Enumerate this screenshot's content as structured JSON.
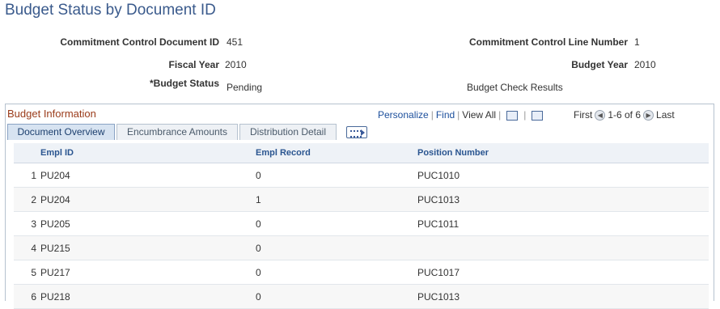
{
  "page_title": "Budget Status by Document ID",
  "fields": {
    "commitment_doc_id_label": "Commitment Control Document ID",
    "commitment_doc_id_value": "451",
    "commitment_line_label": "Commitment Control Line Number",
    "commitment_line_value": "1",
    "fiscal_year_label": "Fiscal Year",
    "fiscal_year_value": "2010",
    "budget_year_label": "Budget Year",
    "budget_year_value": "2010",
    "budget_status_label": "*Budget Status",
    "budget_status_value": "Pending",
    "budget_check_results_link": "Budget Check Results"
  },
  "grid": {
    "title": "Budget Information",
    "personalize": "Personalize",
    "find": "Find",
    "view_all": "View All",
    "first": "First",
    "range": "1-6 of 6",
    "last": "Last",
    "tabs": [
      {
        "label": "Document Overview",
        "active": true
      },
      {
        "label": "Encumbrance Amounts",
        "active": false
      },
      {
        "label": "Distribution Detail",
        "active": false
      }
    ],
    "columns": [
      "Empl ID",
      "Empl Record",
      "Position Number"
    ],
    "rows": [
      {
        "num": "1",
        "empl_id": "PU204",
        "empl_record": "0",
        "position": "PUC1010"
      },
      {
        "num": "2",
        "empl_id": "PU204",
        "empl_record": "1",
        "position": "PUC1013"
      },
      {
        "num": "3",
        "empl_id": "PU205",
        "empl_record": "0",
        "position": "PUC1011"
      },
      {
        "num": "4",
        "empl_id": "PU215",
        "empl_record": "0",
        "position": ""
      },
      {
        "num": "5",
        "empl_id": "PU217",
        "empl_record": "0",
        "position": "PUC1017"
      },
      {
        "num": "6",
        "empl_id": "PU218",
        "empl_record": "0",
        "position": "PUC1013"
      }
    ]
  }
}
